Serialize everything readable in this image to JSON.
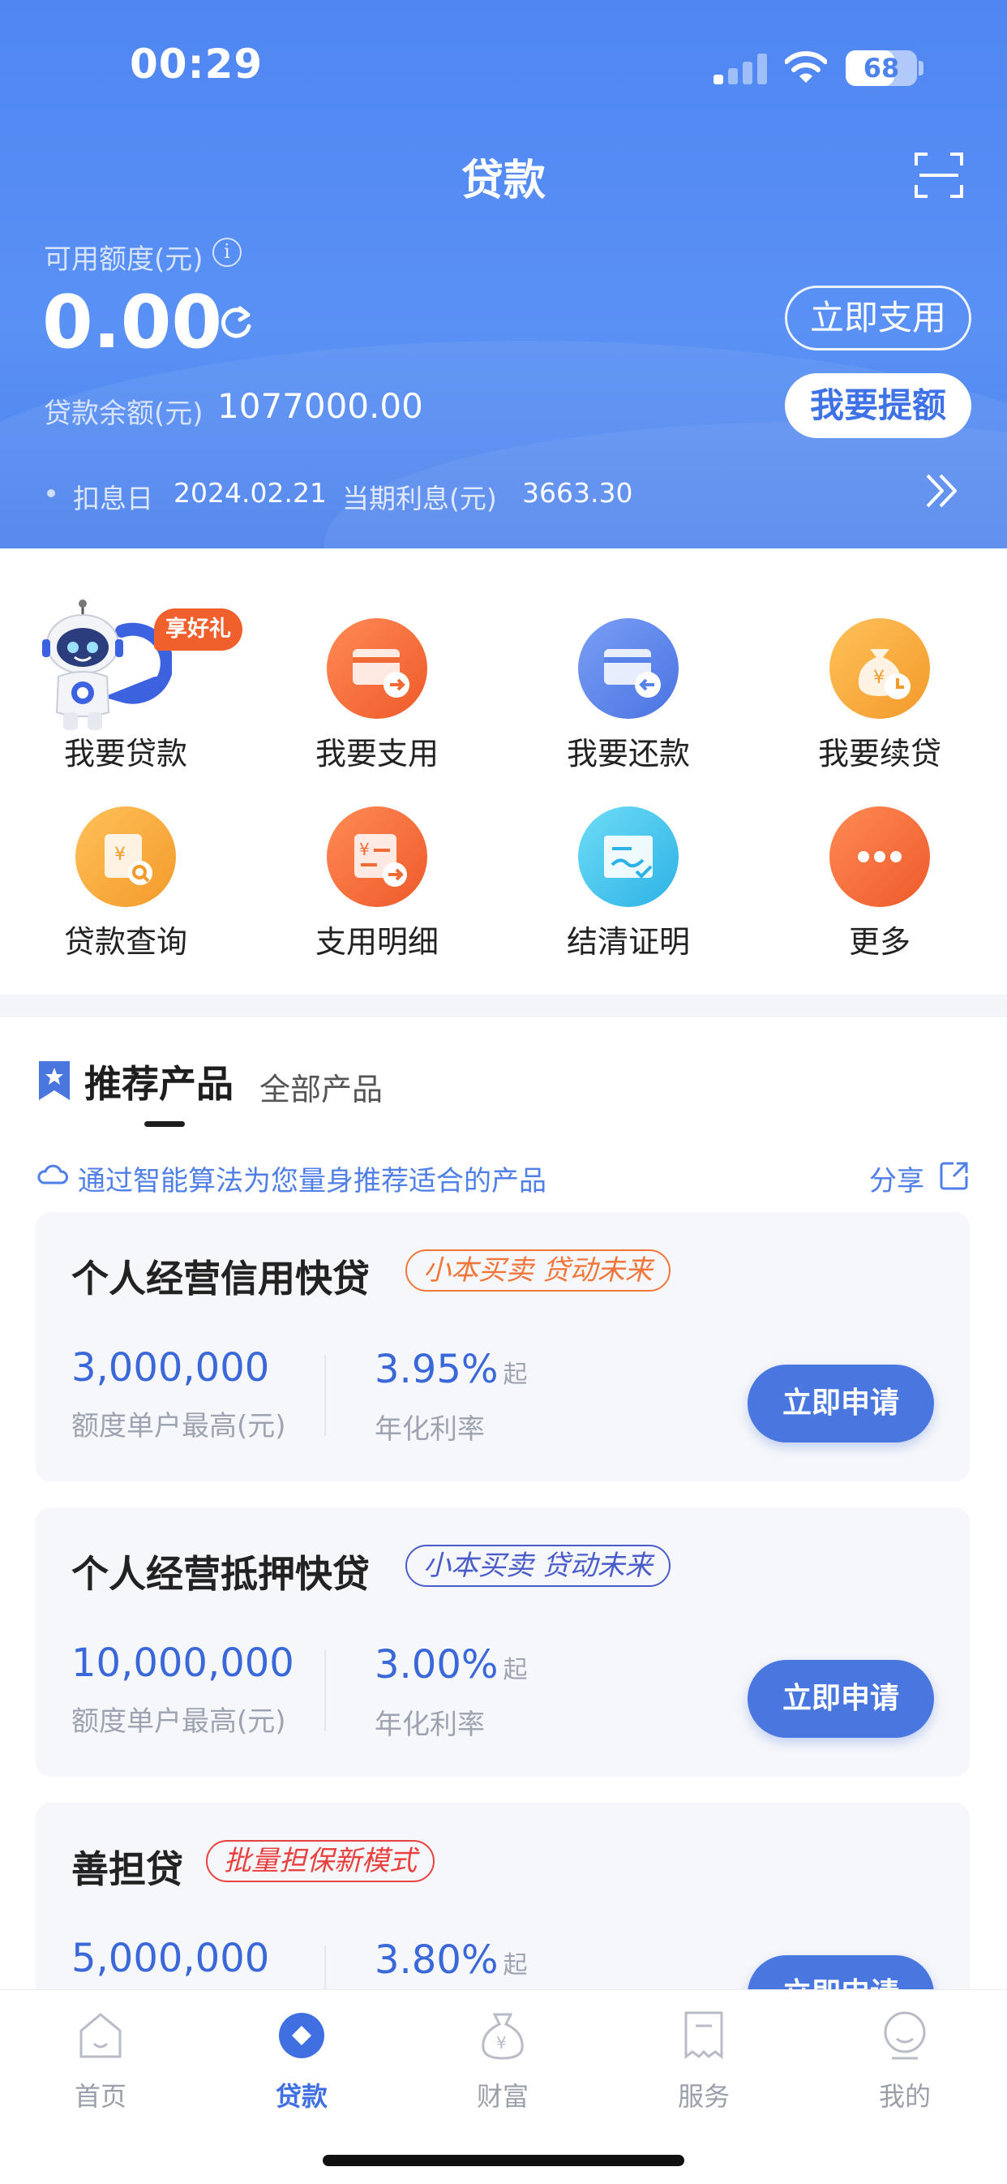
{
  "status_bar": {
    "time": "00:29",
    "battery": "68",
    "battery_level": 0.68
  },
  "header": {
    "title": "贷款"
  },
  "account": {
    "available_label": "可用额度(元)",
    "available_value": "0.00",
    "use_button": "立即支用",
    "balance_label": "贷款余额(元)",
    "balance_value": "1077000.00",
    "raise_button": "我要提额",
    "interest_date_label": "扣息日",
    "interest_date": "2024.02.21",
    "current_interest_label": "当期利息(元)",
    "current_interest": "3663.30"
  },
  "menu": {
    "gift_badge": "享好礼",
    "items": [
      {
        "label": "我要贷款",
        "icon": "robot-mascot-icon"
      },
      {
        "label": "我要支用",
        "icon": "card-transfer-icon",
        "color": "#f26a35"
      },
      {
        "label": "我要还款",
        "icon": "card-repay-icon",
        "color": "#5a83ea"
      },
      {
        "label": "我要续贷",
        "icon": "money-bag-clock-icon",
        "color": "#f5a83a"
      },
      {
        "label": "贷款查询",
        "icon": "yuan-search-icon",
        "color": "#f5a83a"
      },
      {
        "label": "支用明细",
        "icon": "yuan-list-icon",
        "color": "#f26a35"
      },
      {
        "label": "结清证明",
        "icon": "certificate-check-icon",
        "color": "#3cbfe8"
      },
      {
        "label": "更多",
        "icon": "more-dots-icon",
        "color": "#f26a35"
      }
    ]
  },
  "products": {
    "tab_recommended": "推荐产品",
    "tab_all": "全部产品",
    "hint": "通过智能算法为您量身推荐适合的产品",
    "share": "分享",
    "amount_label": "额度单户最高(元)",
    "rate_label": "年化利率",
    "rate_suffix": "起",
    "apply_label": "立即申请",
    "cards": [
      {
        "name": "个人经营信用快贷",
        "tag": "小本买卖 贷动未来",
        "tag_color": "#f0763c",
        "amount": "3,000,000",
        "rate": "3.95%"
      },
      {
        "name": "个人经营抵押快贷",
        "tag": "小本买卖 贷动未来",
        "tag_color": "#4a5cc9",
        "amount": "10,000,000",
        "rate": "3.00%"
      },
      {
        "name": "善担贷",
        "tag": "批量担保新模式",
        "tag_color": "#e8413f",
        "amount": "5,000,000",
        "rate": "3.80%"
      }
    ]
  },
  "nav": {
    "items": [
      {
        "label": "首页"
      },
      {
        "label": "贷款"
      },
      {
        "label": "财富"
      },
      {
        "label": "服务"
      },
      {
        "label": "我的"
      }
    ],
    "active": "贷款"
  }
}
